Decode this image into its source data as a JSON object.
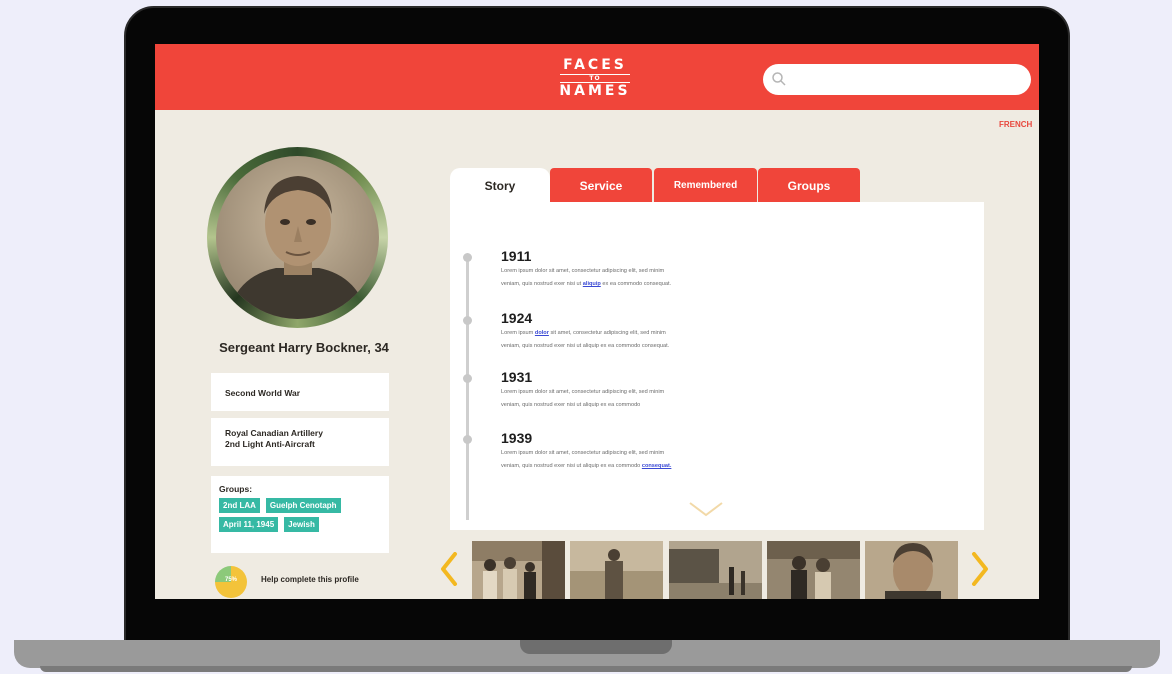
{
  "header": {
    "logo_top": "FACES",
    "logo_mid": "TO",
    "logo_bottom": "NAMES",
    "search_placeholder": ""
  },
  "language_link": "FRENCH",
  "profile": {
    "name": "Sergeant Harry Bockner, 34",
    "conflict": "Second World War",
    "unit_line1": "Royal Canadian Artillery",
    "unit_line2": "2nd Light Anti-Aircraft",
    "groups_label": "Groups:",
    "groups": [
      "2nd LAA",
      "Guelph Cenotaph",
      "April 11, 1945",
      "Jewish"
    ],
    "completion": 75,
    "completion_label": "75%",
    "help_text": "Help complete this profile"
  },
  "tabs": [
    {
      "label": "Story"
    },
    {
      "label": "Service"
    },
    {
      "label": "Remembered"
    },
    {
      "label": "Groups"
    }
  ],
  "timeline": [
    {
      "year": "1911",
      "line1": "Lorem ipsum dolor sit amet, consectetur adipiscing elit, sed minim",
      "line2a": "veniam, quis nostrud exer nisi ut",
      "link": "aliquip",
      "line2b": "ex ea commodo consequat."
    },
    {
      "year": "1924",
      "line1a": "Lorem ipsum",
      "link": "dolor",
      "line1b": "sit amet, consectetur adipiscing elit, sed minim",
      "line2": "veniam, quis nostrud exer nisi ut aliquip ex ea commodo consequat."
    },
    {
      "year": "1931",
      "line1": "Lorem ipsum dolor sit amet, consectetur adipiscing elit, sed minim",
      "line2": "veniam, quis nostrud exer nisi ut aliquip ex ea commodo"
    },
    {
      "year": "1939",
      "line1": "Lorem ipsum dolor sit amet, consectetur adipiscing elit, sed minim",
      "line2a": "veniam, quis nostrud exer nisi ut aliquip ex ea commodo",
      "link": "consequat."
    }
  ],
  "colors": {
    "brand_red": "#f0453a",
    "tag_teal": "#36b9a4",
    "arrow_yellow": "#f3b820",
    "progress_green": "#8cc97a",
    "progress_yellow": "#f3c33a"
  },
  "icons": {
    "search": "search-icon",
    "prev": "chevron-left-icon",
    "next": "chevron-right-icon",
    "more": "chevron-down-icon"
  }
}
